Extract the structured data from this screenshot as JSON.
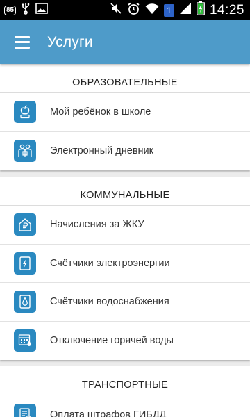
{
  "statusbar": {
    "battery_badge": "85",
    "notif_count": "1",
    "time": "14:25"
  },
  "appbar": {
    "title": "Услуги"
  },
  "sections": [
    {
      "header": "ОБРАЗОВАТЕЛЬНЫЕ",
      "items": [
        {
          "label": "Мой ребёнок в школе",
          "icon": "apple-book-icon"
        },
        {
          "label": "Электронный дневник",
          "icon": "children-icon"
        }
      ]
    },
    {
      "header": "КОММУНАЛЬНЫЕ",
      "items": [
        {
          "label": "Начисления за ЖКУ",
          "icon": "house-ruble-icon"
        },
        {
          "label": "Счётчики электроэнергии",
          "icon": "lightning-meter-icon"
        },
        {
          "label": "Счётчики водоснабжения",
          "icon": "water-drop-meter-icon"
        },
        {
          "label": "Отключение горячей воды",
          "icon": "calendar-drop-icon"
        }
      ]
    },
    {
      "header": "ТРАНСПОРТНЫЕ",
      "items": [
        {
          "label": "Оплата штрафов ГИБДД",
          "icon": "document-ruble-icon"
        }
      ]
    }
  ],
  "colors": {
    "appbar": "#4e9bc9",
    "icon_bg": "#2a89c0",
    "background": "#ececec"
  }
}
